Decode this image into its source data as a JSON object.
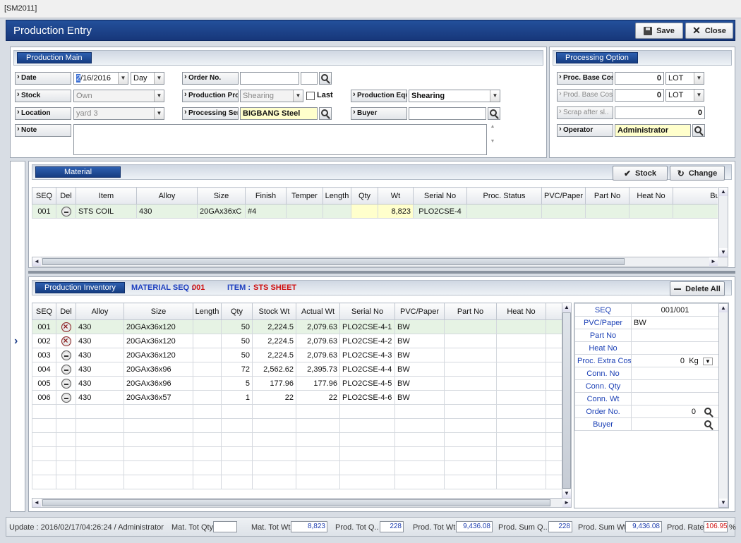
{
  "window_title": "[SM2011]",
  "form_title": "Production Entry",
  "toolbar": {
    "save_label": "Save",
    "close_label": "Close"
  },
  "production_main": {
    "title": "Production Main",
    "date_label": "Date",
    "date_value": "2/16/2016",
    "date_sel": "2",
    "date_rest": "/16/2016",
    "day_value": "Day",
    "order_no_label": "Order No.",
    "order_no_value": "",
    "stock_label": "Stock",
    "stock_value": "Own",
    "production_pro_label": "Production Pro..",
    "production_pro_value": "Shearing",
    "last_label": "Last",
    "production_equ_label": "Production Equ..",
    "production_equ_value": "Shearing",
    "location_label": "Location",
    "location_value": "yard 3",
    "processing_ser_label": "Processing Ser..",
    "processing_ser_value": "BIGBANG Steel",
    "buyer_label": "Buyer",
    "buyer_value": "",
    "note_label": "Note",
    "note_value": ""
  },
  "processing_option": {
    "title": "Processing Option",
    "base_cost_label": "Proc. Base Cost",
    "base_cost_value": "0",
    "base_cost_unit": "LOT",
    "prod_base_cost_label": "Prod. Base Cost",
    "prod_base_cost_value": "0",
    "prod_base_cost_unit": "LOT",
    "scrap_label": "Scrap after sl..",
    "scrap_value": "0",
    "operator_label": "Operator",
    "operator_value": "Administrator"
  },
  "material": {
    "title": "Material",
    "stock_btn": "Stock",
    "change_btn": "Change",
    "columns": [
      "SEQ",
      "Del",
      "Item",
      "Alloy",
      "Size",
      "Finish",
      "Temper",
      "Length",
      "Qty",
      "Wt",
      "Serial No",
      "Proc. Status",
      "PVC/Paper",
      "Part No",
      "Heat No",
      "Buyer"
    ],
    "rows": [
      {
        "seq": "001",
        "item": "STS COIL",
        "alloy": "430",
        "size": "20GAx36xC",
        "finish": "#4",
        "temper": "",
        "length": "",
        "qty": "",
        "wt": "8,823",
        "serial": "PLO2CSE-4",
        "status": "",
        "pvc": "",
        "part": "",
        "heat": "",
        "buyer": ""
      }
    ]
  },
  "inventory": {
    "title": "Production Inventory",
    "mat_seq_label": "MATERIAL SEQ :",
    "mat_seq_value": "001",
    "item_label": "ITEM :",
    "item_value": "STS SHEET",
    "delete_all_btn": "Delete All",
    "columns": [
      "SEQ",
      "Del",
      "Alloy",
      "Size",
      "Length",
      "Qty",
      "Stock Wt",
      "Actual Wt",
      "Serial No",
      "PVC/Paper",
      "Part No",
      "Heat No"
    ],
    "rows": [
      {
        "seq": "001",
        "del": "x",
        "alloy": "430",
        "size": "20GAx36x120",
        "length": "",
        "qty": "50",
        "stock_wt": "2,224.5",
        "actual_wt": "2,079.63",
        "serial": "PLO2CSE-4-1",
        "pvc": "BW"
      },
      {
        "seq": "002",
        "del": "x",
        "alloy": "430",
        "size": "20GAx36x120",
        "length": "",
        "qty": "50",
        "stock_wt": "2,224.5",
        "actual_wt": "2,079.63",
        "serial": "PLO2CSE-4-2",
        "pvc": "BW"
      },
      {
        "seq": "003",
        "del": "minus",
        "alloy": "430",
        "size": "20GAx36x120",
        "length": "",
        "qty": "50",
        "stock_wt": "2,224.5",
        "actual_wt": "2,079.63",
        "serial": "PLO2CSE-4-3",
        "pvc": "BW"
      },
      {
        "seq": "004",
        "del": "minus",
        "alloy": "430",
        "size": "20GAx36x96",
        "length": "",
        "qty": "72",
        "stock_wt": "2,562.62",
        "actual_wt": "2,395.73",
        "serial": "PLO2CSE-4-4",
        "pvc": "BW"
      },
      {
        "seq": "005",
        "del": "minus",
        "alloy": "430",
        "size": "20GAx36x96",
        "length": "",
        "qty": "5",
        "stock_wt": "177.96",
        "actual_wt": "177.96",
        "serial": "PLO2CSE-4-5",
        "pvc": "BW"
      },
      {
        "seq": "006",
        "del": "minus",
        "alloy": "430",
        "size": "20GAx36x57",
        "length": "",
        "qty": "1",
        "stock_wt": "22",
        "actual_wt": "22",
        "serial": "PLO2CSE-4-6",
        "pvc": "BW"
      }
    ]
  },
  "detail": {
    "seq_label": "SEQ",
    "seq_value": "001/001",
    "pvc_label": "PVC/Paper",
    "pvc_value": "BW",
    "part_label": "Part No",
    "heat_label": "Heat No",
    "extra_cost_label": "Proc. Extra Cost",
    "extra_cost_value": "0",
    "extra_cost_unit": "Kg",
    "conn_no_label": "Conn. No",
    "conn_qty_label": "Conn. Qty",
    "conn_wt_label": "Conn. Wt",
    "order_no_label": "Order No.",
    "order_no_value": "0",
    "buyer_label": "Buyer"
  },
  "status": {
    "update_text": "Update : 2016/02/17/04:26:24 / Administrator",
    "mat_tot_qty_label": "Mat. Tot Qty",
    "mat_tot_qty": "",
    "mat_tot_wt_label": "Mat. Tot Wt",
    "mat_tot_wt": "8,823",
    "prod_tot_q_label": "Prod. Tot Q..",
    "prod_tot_q": "228",
    "prod_tot_wt_label": "Prod. Tot Wt",
    "prod_tot_wt": "9,436.08",
    "prod_sum_q_label": "Prod. Sum Q..",
    "prod_sum_q": "228",
    "prod_sum_wt_label": "Prod. Sum Wt",
    "prod_sum_wt": "9,436.08",
    "prod_rate_label": "Prod. Rate",
    "prod_rate": "106.95",
    "pct": "%"
  },
  "colors": {
    "title_blue": "#1d4590",
    "highlight": "#ffffcc",
    "rate_red": "#d01010",
    "selected_row": "#e6f3e4"
  }
}
